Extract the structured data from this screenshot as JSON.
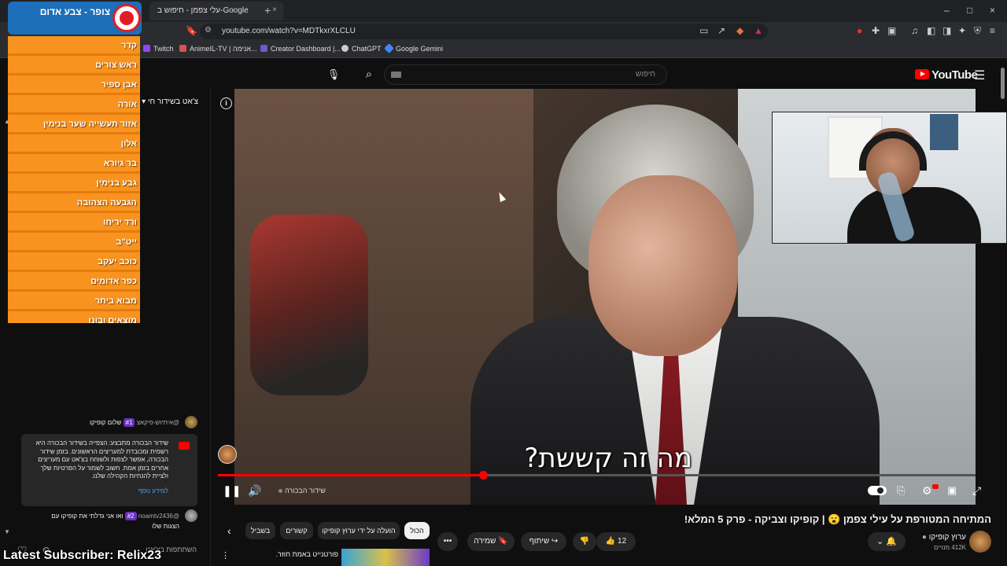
{
  "browser": {
    "tab_title": "עלי צפמן - חיפוש ב-Google",
    "tab_close": "×",
    "new_tab": "+",
    "window_controls": [
      "–",
      "□",
      "×"
    ],
    "url": "youtube.com/watch?v=MDTkxrXLCLU",
    "bookmarks": [
      {
        "label": "Twitch",
        "color": "#9146ff"
      },
      {
        "label": "AnimeIL-TV | אנימה...",
        "color": "#d9534f"
      },
      {
        "label": "Creator Dashboard |...",
        "color": "#6a5acd"
      },
      {
        "label": "ChatGPT",
        "color": "#cccccc"
      },
      {
        "label": "Google Gemini",
        "color": "#4285f4"
      }
    ]
  },
  "header": {
    "search_placeholder": "חיפוש",
    "logo": "YouTube"
  },
  "alert": {
    "title": "צופר - צבע אדום",
    "locations": [
      "קדר",
      "ראש צורים",
      "אבן ספיר",
      "אורה",
      "אזור תעשייה שער בנימין",
      "אלון",
      "בר גיורא",
      "גבע בנימין",
      "הגבעה הצהובה",
      "ורד יריחו",
      "ייט\"ב",
      "כוכב יעקב",
      "כפר אדומים",
      "מבוא ביתר",
      "מוצאים ובונו"
    ]
  },
  "chat": {
    "header": "צ'אט בשידור חי",
    "messages": [
      {
        "author": "@איתיוש-פיקאצ",
        "badge": "#1",
        "text": "שלום קופיקו"
      },
      {
        "author": "@noamtv2436",
        "badge": "#2",
        "text": "ואו אני גדלתי את קופיקו עם",
        "text2": "הצגות שלו"
      }
    ],
    "notice": "שידור הבכורה מתבצע: הצפייה בשידור הבכורה היא רשמית ומכובדת למעריצים הראשונים. בזמן שידור הבכורה, אפשר לצפות ולשוחח בצ'אט עם מעריצים אחרים בזמן אמת. חשוב לשמור על הפרטיות שלך ולציית להנחיות הקהילה שלנו.",
    "notice_link": "למידע נוסף",
    "input_placeholder": "השתתפות בצ'אט"
  },
  "overlay": {
    "latest_subscriber": "Latest Subscriber: Relix23"
  },
  "video": {
    "subtitle": "מה זה קששת?",
    "live_label": "שידור הבכורה",
    "progress": 0.35
  },
  "below": {
    "title": "המתיחה המטורפת על עילי צפמן 😮 | קופיקו וצביקה - פרק 5 המלא!",
    "channel_name": "ערוץ קופיקו",
    "channel_subs": "412K מנויים",
    "like_count": "12",
    "share": "שיתוף",
    "save": "שמירה",
    "more": "•••",
    "chips": [
      "הכול",
      "הועלה על ידי ערוץ קופיקו",
      "קשורים",
      "בשביל"
    ],
    "rec_title": "פורטנייט באמת חוזר."
  }
}
